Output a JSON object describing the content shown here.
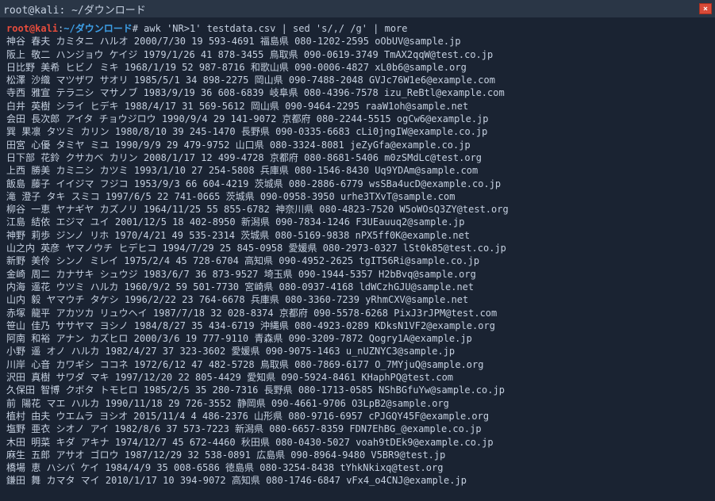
{
  "titlebar": {
    "title": "root@kali: ~/ダウンロード",
    "close": "×"
  },
  "prompt": {
    "user": "root@kali",
    "sep1": ":",
    "path": "~/ダウンロード",
    "sep2": "#",
    "command": " awk 'NR>1' testdata.csv | sed 's/,/ /g' | more"
  },
  "rows": [
    "神谷 春夫 カミタニ ハルオ 2000/7/30 19 593-4691 福島県 080-1202-2595 oObUV@sample.jp",
    "阪上 敬二 ハンジョウ ケイジ 1979/1/26 41 878-3455 鳥取県 090-0619-3749 TmAX2qqW@test.co.jp",
    "日比野 美希 ヒビノ ミキ 1968/1/19 52 987-8716 和歌山県 090-0006-4827 xL0b6@sample.org",
    "松澤 沙織 マツザワ サオリ 1985/5/1 34 898-2275 岡山県 090-7488-2048 GVJc76W1e6@example.com",
    "寺西 雅宣 テラニシ マサノブ 1983/9/19 36 608-6839 岐阜県 080-4396-7578 izu_ReBtl@example.com",
    "白井 英樹 シライ ヒデキ 1988/4/17 31 569-5612 岡山県 090-9464-2295 raaW1oh@sample.net",
    "会田 長次郎 アイタ チョウジロウ 1990/9/4 29 141-9072 京都府 080-2244-5515 ogCw6@example.jp",
    "巽 果凛 タツミ カリン 1980/8/10 39 245-1470 長野県 090-0335-6683 cLi0jngIW@example.co.jp",
    "田宮 心優 タミヤ ミユ 1990/9/9 29 479-9752 山口県 080-3324-8081 jeZyGfa@example.co.jp",
    "日下部 花鈴 クサカベ カリン 2008/1/17 12 499-4728 京都府 080-8681-5406 m0zSMdLc@test.org",
    "上西 勝美 カミニシ カツミ 1993/1/10 27 254-5808 兵庫県 080-1546-8430 Uq9YDAm@sample.com",
    "飯島 藤子 イイジマ フジコ 1953/9/3 66 604-4219 茨城県 080-2886-6779 wsSBa4ucD@example.co.jp",
    "滝 澄子 タキ スミコ 1997/6/5 22 741-0665 茨城県 090-0958-3950 urhe3TXvT@sample.com",
    "柳谷 一恵 ヤナギヤ カズノリ 1964/11/25 55 855-6782 神奈川県 080-4823-7520 W5oWOsQ3ZY@test.org",
    "江島 結依 エジマ ユイ 2001/12/5 18 402-8950 新潟県 090-7834-1246 F3UEauuq2@sample.jp",
    "神野 莉歩 ジンノ リホ 1970/4/21 49 535-2314 茨城県 080-5169-9838 nPX5ff0K@example.net",
    "山之内 英彦 ヤマノウチ ヒデヒコ 1994/7/29 25 845-0958 愛媛県 080-2973-0327 lSt0k85@test.co.jp",
    "新野 美伶 シンノ ミレイ 1975/2/4 45 728-6704 高知県 090-4952-2625 tgIT56Ri@sample.co.jp",
    "金崎 周二 カナサキ シュウジ 1983/6/7 36 873-9527 埼玉県 090-1944-5357 H2bBvq@sample.org",
    "内海 遥花 ウツミ ハルカ 1960/9/2 59 501-7730 宮崎県 080-0937-4168 ldWCzhGJU@sample.net",
    "山内 毅 ヤマウチ タケシ 1996/2/22 23 764-6678 兵庫県 080-3360-7239 yRhmCXV@sample.net",
    "赤塚 龍平 アカツカ リュウヘイ 1987/7/18 32 028-8374 京都府 090-5578-6268 PixJ3rJPM@test.com",
    "笹山 佳乃 ササヤマ ヨシノ 1984/8/27 35 434-6719 沖縄県 080-4923-0289 KDksN1VF2@example.org",
    "阿南 和裕 アナン カズヒロ 2000/3/6 19 777-9110 青森県 090-3209-7872 Qogry1A@example.jp",
    "小野 遥 オノ ハルカ 1982/4/27 37 323-3602 愛媛県 090-9075-1463 u_nUZNYC3@sample.jp",
    "川岸 心音 カワギシ ココネ 1972/6/12 47 482-5728 鳥取県 080-7869-6177 O_7MYjuQ@sample.org",
    "沢田 真樹 サワダ マキ 1997/12/20 22 805-4429 愛知県 090-5924-8461 KHaphPQ@test.com",
    "久保田 智博 クボタ トモヒロ 1985/2/5 35 280-7316 長野県 080-1713-0585 NShBGfuYw@sample.co.jp",
    "前 陽花 マエ ハルカ 1990/11/18 29 726-3552 静岡県 090-4661-9706 O3LpB2@sample.org",
    "植村 由夫 ウエムラ ヨシオ 2015/11/4 4 486-2376 山形県 080-9716-6957 cPJGQY45F@example.org",
    "塩野 亜衣 シオノ アイ 1982/8/6 37 573-7223 新潟県 080-6657-8359 FDN7EhBG_@example.co.jp",
    "木田 明菜 キダ アキナ 1974/12/7 45 672-4460 秋田県 080-0430-5027 voah9tDEk9@example.co.jp",
    "麻生 五郎 アサオ ゴロウ 1987/12/29 32 538-0891 広島県 090-8964-9480 V5BR9@test.jp",
    "橋場 恵 ハシバ ケイ 1984/4/9 35 008-6586 徳島県 080-3254-8438 tYhkNkixq@test.org",
    "鎌田 舞 カマタ マイ 2010/1/17 10 394-9072 高知県 080-1746-6847 vFx4_o4CNJ@example.jp"
  ]
}
